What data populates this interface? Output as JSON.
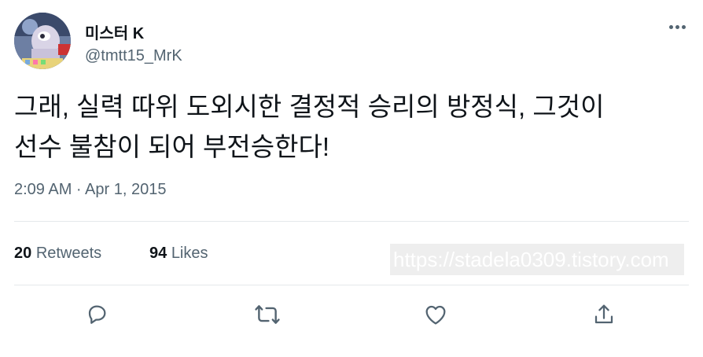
{
  "user": {
    "display_name": "미스터 K",
    "handle": "@tmtt15_MrK"
  },
  "tweet": {
    "text": "그래, 실력 따위 도외시한 결정적 승리의 방정식, 그것이\n선수 불참이 되어 부전승한다!",
    "timestamp": "2:09 AM · Apr 1, 2015"
  },
  "stats": {
    "retweets_count": "20",
    "retweets_label": "Retweets",
    "likes_count": "94",
    "likes_label": "Likes"
  },
  "watermark": "https://stadela0309.tistory.com",
  "actions": [
    "reply-icon",
    "retweet-icon",
    "like-icon",
    "share-icon"
  ],
  "colors": {
    "text": "#0f1419",
    "secondary": "#536471",
    "divider": "#e4e8eb"
  }
}
